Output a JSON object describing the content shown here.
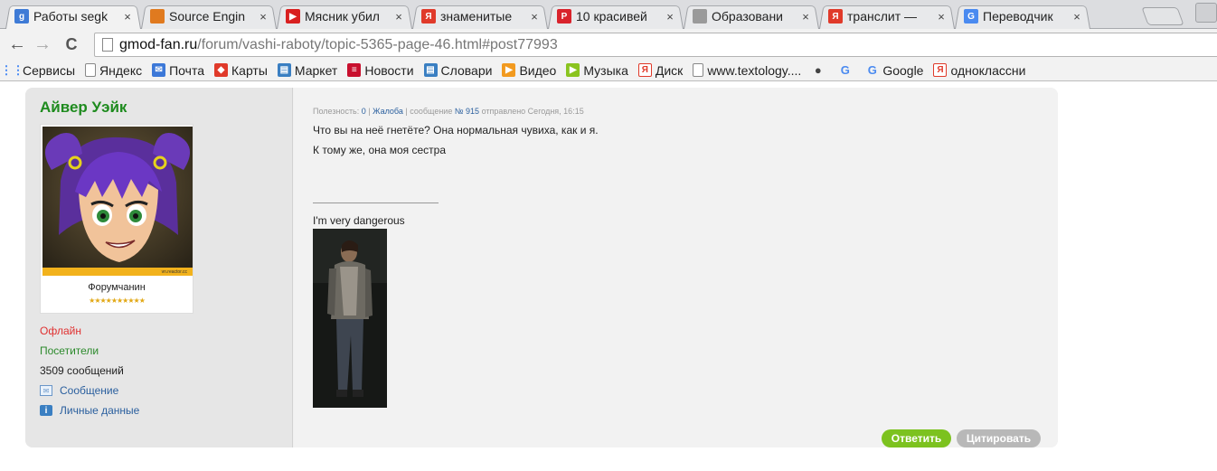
{
  "browser": {
    "tabs": [
      {
        "title": "Работы segk",
        "favicon": "g",
        "favicon_color": "#3f7bd6",
        "active": true
      },
      {
        "title": "Source Engin",
        "favicon": "",
        "favicon_color": "#e07a1f",
        "active": false
      },
      {
        "title": "Мясник убил",
        "favicon": "▶",
        "favicon_color": "#d92020",
        "active": false
      },
      {
        "title": "знаменитые",
        "favicon": "Я",
        "favicon_color": "#e03a2a",
        "active": false
      },
      {
        "title": "10 красивей",
        "favicon": "P",
        "favicon_color": "#d9232c",
        "active": false
      },
      {
        "title": "Образовани",
        "favicon": "",
        "favicon_color": "#9a9a9a",
        "active": false
      },
      {
        "title": "транслит —",
        "favicon": "Я",
        "favicon_color": "#e03a2a",
        "active": false
      },
      {
        "title": "Переводчик",
        "favicon": "G",
        "favicon_color": "#4a8af0",
        "active": false
      }
    ],
    "close_glyph": "×",
    "address": {
      "host": "gmod-fan.ru",
      "path": "/forum/vashi-raboty/topic-5365-page-46.html#post77993"
    },
    "nav": {
      "back": "←",
      "forward": "→",
      "reload": "C"
    },
    "bookmarks": [
      {
        "label": "Сервисы",
        "icon": "apps-icon",
        "color": "#4285f4",
        "glyph": "⋮⋮"
      },
      {
        "label": "Яндекс",
        "icon": "page-icon",
        "color": "#9a9a9a",
        "glyph": ""
      },
      {
        "label": "Почта",
        "icon": "mail-icon",
        "color": "#3c78d8",
        "glyph": "✉"
      },
      {
        "label": "Карты",
        "icon": "maps-icon",
        "color": "#e03a2a",
        "glyph": "◆"
      },
      {
        "label": "Маркет",
        "icon": "market-icon",
        "color": "#3a7fc2",
        "glyph": "▤"
      },
      {
        "label": "Новости",
        "icon": "news-icon",
        "color": "#c8102e",
        "glyph": "≡"
      },
      {
        "label": "Словари",
        "icon": "dict-icon",
        "color": "#3a7fc2",
        "glyph": "▤"
      },
      {
        "label": "Видео",
        "icon": "video-icon",
        "color": "#f29a1f",
        "glyph": "▶"
      },
      {
        "label": "Музыка",
        "icon": "music-icon",
        "color": "#8ac41f",
        "glyph": "▶"
      },
      {
        "label": "Диск",
        "icon": "disk-icon",
        "color": "#e03a2a",
        "glyph": "Я"
      },
      {
        "label": "www.textology....",
        "icon": "page-icon",
        "color": "#9a9a9a",
        "glyph": ""
      },
      {
        "label": "",
        "icon": "globe-icon",
        "color": "#444",
        "glyph": "●"
      },
      {
        "label": "",
        "icon": "google-g-icon",
        "color": "#4a8af0",
        "glyph": "G"
      },
      {
        "label": "Google",
        "icon": "google-g-icon",
        "color": "#4a8af0",
        "glyph": "G"
      },
      {
        "label": "одноклассни",
        "icon": "yandex-icon",
        "color": "#e03a2a",
        "glyph": "Я"
      }
    ]
  },
  "post": {
    "author": {
      "name": "Айвер Уэйк",
      "rank": "Форумчанин",
      "stars": "★★★★★★★★★★",
      "status": "Офлайн",
      "group": "Посетители",
      "messages": "3509 сообщений",
      "send_message": "Сообщение",
      "profile": "Личные данные",
      "avatar_watermark": "vn.reactor.cc"
    },
    "meta": {
      "usefulness_label": "Полезность:",
      "usefulness_value": "0",
      "separator": "|",
      "complaint": "Жалоба",
      "message_label": "сообщение",
      "message_number": "№ 915",
      "sent": "отправлено Сегодня, 16:15"
    },
    "body": {
      "line1": "Что вы на неё гнетёте? Она нормальная чувиха, как и я.",
      "line2": "К тому же, она моя сестра"
    },
    "signature": "I'm very dangerous",
    "buttons": {
      "reply": "Ответить",
      "quote": "Цитировать"
    }
  }
}
